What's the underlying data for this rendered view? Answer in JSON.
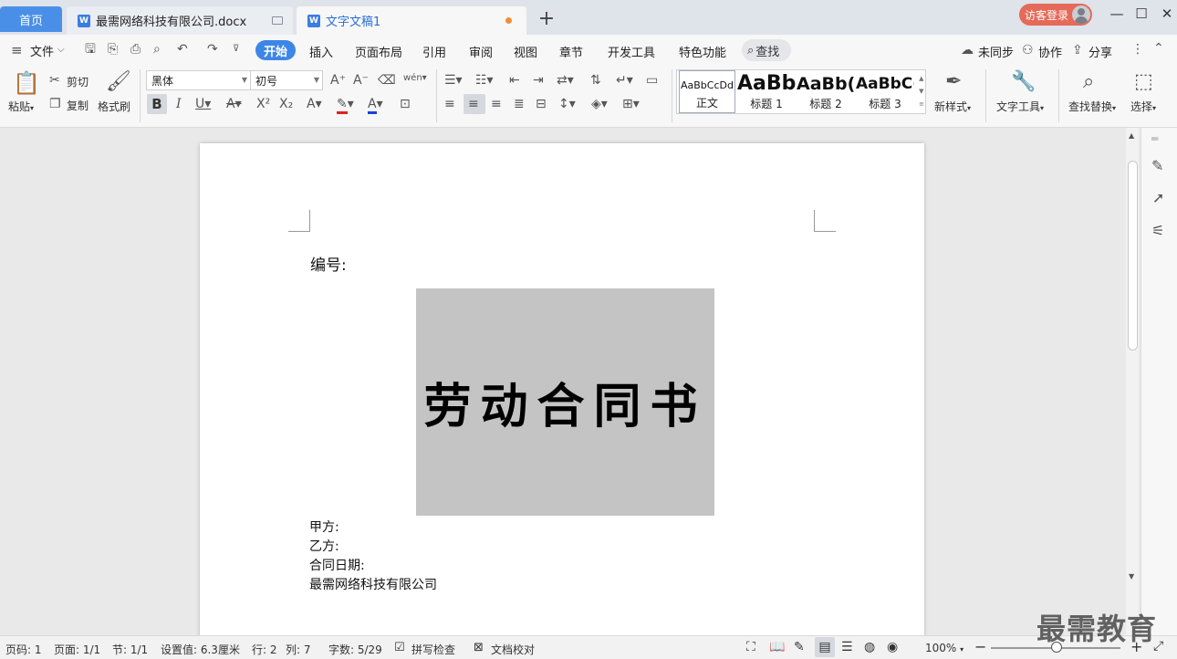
{
  "tabs": {
    "home": "首页",
    "doc1": "最需网络科技有限公司.docx",
    "doc2": "文字文稿1",
    "add": "+"
  },
  "account": {
    "guest_login": "访客登录"
  },
  "window": {
    "minimize": "—",
    "maximize": "☐",
    "close": "✕"
  },
  "menu": {
    "file": "文件",
    "start": "开始",
    "items": [
      "插入",
      "页面布局",
      "引用",
      "审阅",
      "视图",
      "章节",
      "开发工具",
      "特色功能"
    ],
    "search": "查找",
    "unsynced": "未同步",
    "collab": "协作",
    "share": "分享"
  },
  "ribbon": {
    "paste": "粘贴",
    "cut": "剪切",
    "copy": "复制",
    "format_painter": "格式刷",
    "font_name": "黑体",
    "font_size": "初号",
    "phonetic": "wén",
    "new_style": "新样式",
    "text_tools": "文字工具",
    "find_replace": "查找替换",
    "select": "选择",
    "styles": [
      {
        "sample": "AaBbCcDd",
        "name": "正文"
      },
      {
        "sample": "AaBb",
        "name": "标题 1"
      },
      {
        "sample": "AaBb(",
        "name": "标题 2"
      },
      {
        "sample": "AaBbC(",
        "name": "标题 3"
      }
    ]
  },
  "document": {
    "number_label": "编号:",
    "title": "劳动合同书",
    "party_a": "甲方:",
    "party_b": "乙方:",
    "contract_date": "合同日期:",
    "company": "最需网络科技有限公司"
  },
  "status": {
    "page": "页码: 1",
    "pages": "页面: 1/1",
    "section": "节: 1/1",
    "setting": "设置值: 6.3厘米",
    "row": "行: 2",
    "col": "列: 7",
    "words": "字数: 5/29",
    "spell_check": "拼写检查",
    "doc_proof": "文档校对",
    "zoom": "100%",
    "zoom_percent": 100
  },
  "watermark": "最需教育",
  "colors": {
    "accent": "#3d86e8",
    "guest_btn": "#e56a58",
    "highlight": "#c4c4c4"
  }
}
